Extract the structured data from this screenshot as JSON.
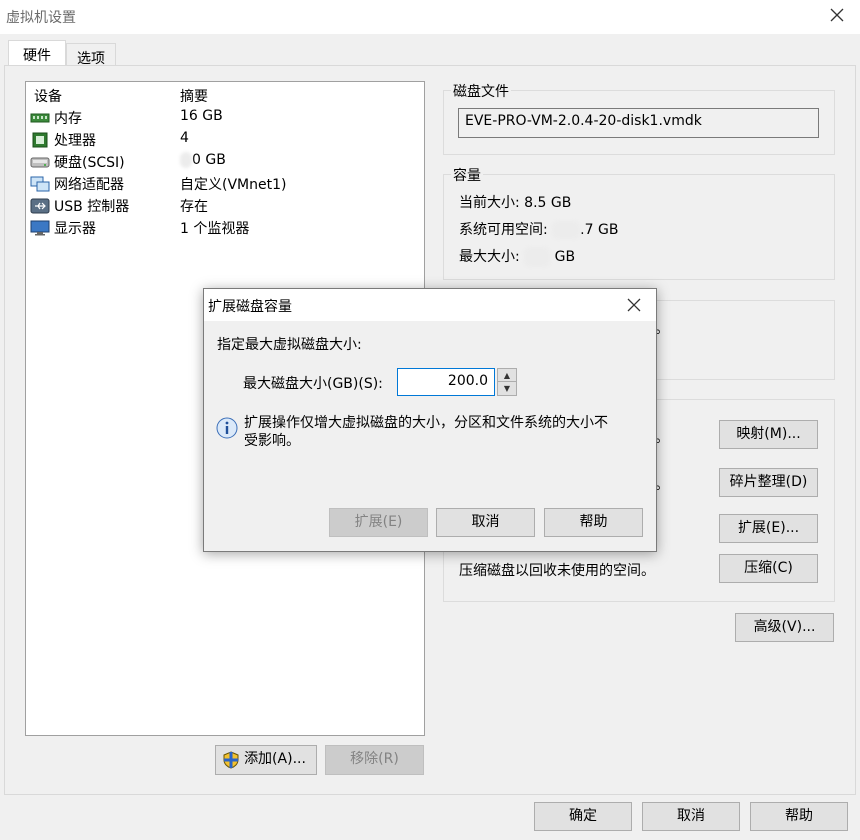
{
  "window": {
    "title": "虚拟机设置"
  },
  "tabs": [
    {
      "label": "硬件"
    },
    {
      "label": "选项"
    }
  ],
  "device_list": {
    "columns": {
      "device": "设备",
      "summary": "摘要"
    },
    "rows": [
      {
        "name": "内存",
        "summary": "16 GB",
        "icon": "memory-icon"
      },
      {
        "name": "处理器",
        "summary": "4",
        "icon": "cpu-icon"
      },
      {
        "name": "硬盘(SCSI)",
        "summary": "0 GB",
        "icon": "harddisk-icon"
      },
      {
        "name": "网络适配器",
        "summary": "自定义(VMnet1)",
        "icon": "network-adapter-icon"
      },
      {
        "name": "USB 控制器",
        "summary": "存在",
        "icon": "usb-icon"
      },
      {
        "name": "显示器",
        "summary": "1 个监视器",
        "icon": "monitor-icon"
      }
    ]
  },
  "list_buttons": {
    "add": "添加(A)...",
    "remove": "移除(R)"
  },
  "disk_file": {
    "title": "磁盘文件",
    "value": "EVE-PRO-VM-2.0.4-20-disk1.vmdk"
  },
  "capacity": {
    "title": "容量",
    "current_label": "当前大小: 8.5 GB",
    "free_label": "系统可用空间:",
    "free_value": ".7 GB",
    "max_label": "最大大小:",
    "max_value": "GB"
  },
  "utilities": {
    "map_button": "映射(M)...",
    "defrag_button": "碎片整理(D)",
    "expand_button": "扩展(E)...",
    "compact_text": "压缩磁盘以回收未使用的空间。",
    "compact_button": "压缩(C)",
    "partial_1": "。",
    "partial_2": "。",
    "partial_3": "。",
    "partial_4": "。"
  },
  "advanced_button": "高级(V)...",
  "footer": {
    "ok": "确定",
    "cancel": "取消",
    "help": "帮助"
  },
  "dialog": {
    "title": "扩展磁盘容量",
    "prompt": "指定最大虚拟磁盘大小:",
    "field_label": "最大磁盘大小(GB)(S):",
    "field_value": "200.0",
    "info_text_line1": "扩展操作仅增大虚拟磁盘的大小，分区和文件系统的大小不",
    "info_text_line2": "受影响。",
    "expand_button": "扩展(E)",
    "cancel_button": "取消",
    "help_button": "帮助"
  }
}
